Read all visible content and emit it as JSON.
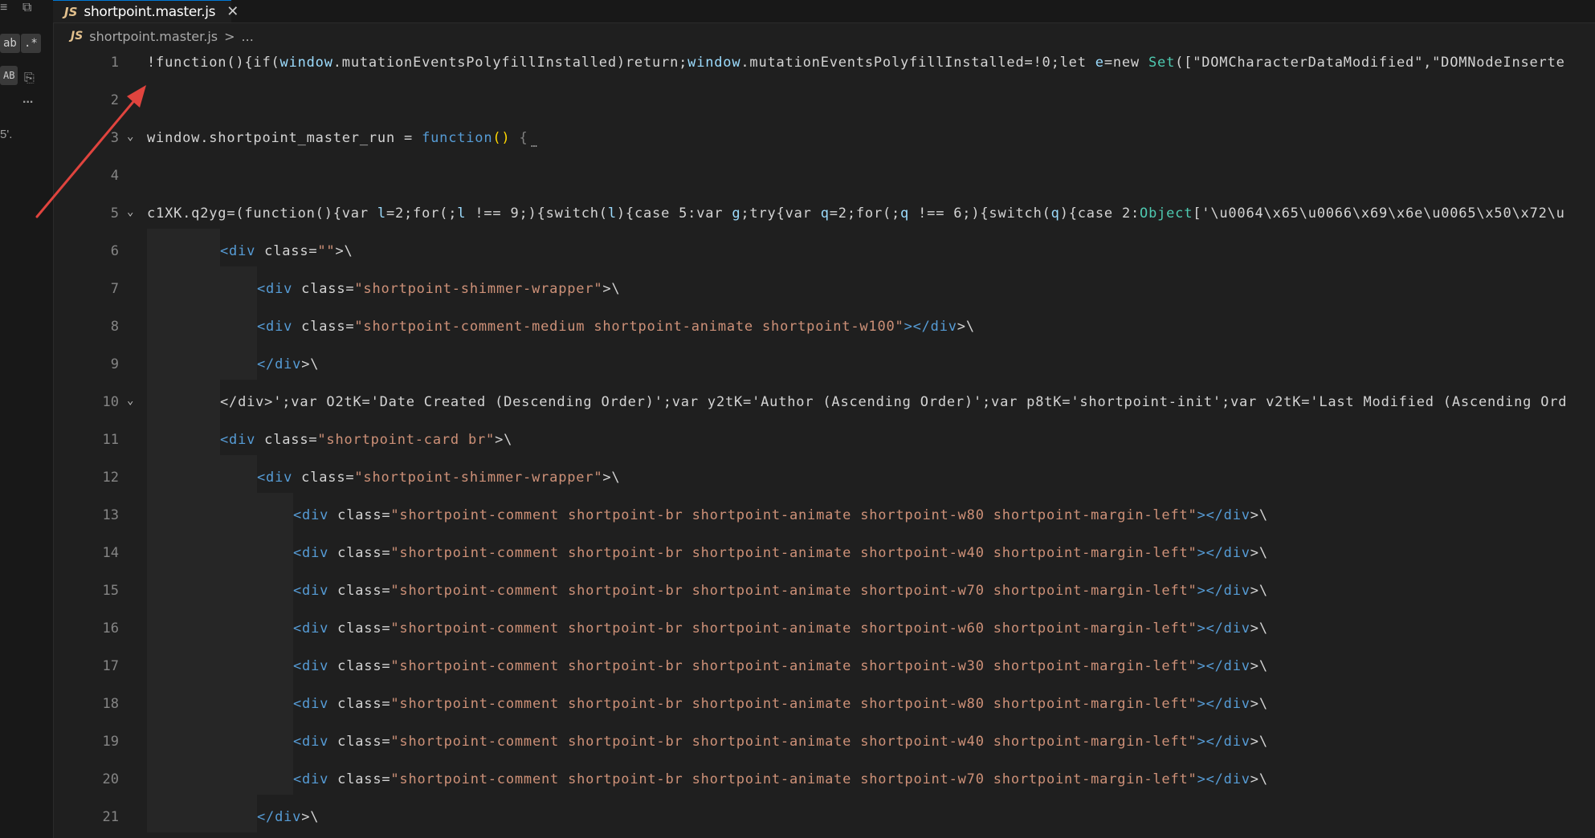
{
  "leftbar": {
    "match_case_label": "ab",
    "regex_label": ".*",
    "ab_label": "AB",
    "more_label": "...",
    "fragment_text": "5'."
  },
  "tab": {
    "icon": "JS",
    "title": "shortpoint.master.js",
    "close": "✕"
  },
  "breadcrumb": {
    "icon": "JS",
    "file": "shortpoint.master.js",
    "separator": ">",
    "more": "..."
  },
  "editor": {
    "lines": [
      {
        "number": "1",
        "fold": "",
        "indent": "",
        "tokens": [
          {
            "text": "!function(){if(",
            "class": "default"
          },
          {
            "text": "window",
            "class": "variable"
          },
          {
            "text": ".mutationEventsPolyfillInstalled)return;",
            "class": "default"
          },
          {
            "text": "window",
            "class": "variable"
          },
          {
            "text": ".mutationEventsPolyfillInstalled=!0;let ",
            "class": "default"
          },
          {
            "text": "e",
            "class": "variable"
          },
          {
            "text": "=new ",
            "class": "default"
          },
          {
            "text": "Set",
            "class": "class"
          },
          {
            "text": "([\"DOMCharacterDataModified\",\"DOMNodeInserte",
            "class": "default"
          }
        ]
      },
      {
        "number": "2",
        "fold": "",
        "indent": "",
        "tokens": []
      },
      {
        "number": "3",
        "fold": "⌄",
        "indent": "",
        "tokens": [
          {
            "text": "window.shortpoint_master_run = ",
            "class": "default"
          },
          {
            "text": "function",
            "class": "keyword"
          },
          {
            "text": "()",
            "class": "bracket"
          },
          {
            "text": " ",
            "class": "default"
          },
          {
            "text": "{",
            "class": "punct"
          }
        ],
        "ellipsis": "…"
      },
      {
        "number": "4",
        "fold": "",
        "indent": "",
        "tokens": []
      },
      {
        "number": "5",
        "fold": "⌄",
        "indent": "",
        "tokens": [
          {
            "text": "c1XK.q2yg=(function(){var ",
            "class": "default"
          },
          {
            "text": "l",
            "class": "variable"
          },
          {
            "text": "=2;for(;",
            "class": "default"
          },
          {
            "text": "l",
            "class": "variable"
          },
          {
            "text": " !== 9;){switch(",
            "class": "default"
          },
          {
            "text": "l",
            "class": "variable"
          },
          {
            "text": "){case 5:var ",
            "class": "default"
          },
          {
            "text": "g",
            "class": "variable"
          },
          {
            "text": ";try{var ",
            "class": "default"
          },
          {
            "text": "q",
            "class": "variable"
          },
          {
            "text": "=2;for(;",
            "class": "default"
          },
          {
            "text": "q",
            "class": "variable"
          },
          {
            "text": " !== 6;){switch(",
            "class": "default"
          },
          {
            "text": "q",
            "class": "variable"
          },
          {
            "text": "){case 2:",
            "class": "default"
          },
          {
            "text": "Object",
            "class": "class"
          },
          {
            "text": "['\\u0064\\x65\\u0066\\x69\\x6e\\u0065\\x50\\x72\\u",
            "class": "default"
          }
        ]
      },
      {
        "number": "6",
        "fold": "",
        "indent": "    ",
        "tokens": [
          {
            "text": "<div",
            "class": "tag"
          },
          {
            "text": " class=",
            "class": "default"
          },
          {
            "text": "\"\"",
            "class": "string"
          },
          {
            "text": ">\\",
            "class": "default"
          }
        ]
      },
      {
        "number": "7",
        "fold": "",
        "indent": "      ",
        "tokens": [
          {
            "text": "<div",
            "class": "tag"
          },
          {
            "text": " class=",
            "class": "default"
          },
          {
            "text": "\"shortpoint-shimmer-wrapper\"",
            "class": "string"
          },
          {
            "text": ">\\",
            "class": "default"
          }
        ]
      },
      {
        "number": "8",
        "fold": "",
        "indent": "      ",
        "tokens": [
          {
            "text": "<div",
            "class": "tag"
          },
          {
            "text": " class=",
            "class": "default"
          },
          {
            "text": "\"shortpoint-comment-medium shortpoint-animate shortpoint-w100\"",
            "class": "string"
          },
          {
            "text": "></div",
            "class": "tag"
          },
          {
            "text": ">\\",
            "class": "default"
          }
        ]
      },
      {
        "number": "9",
        "fold": "",
        "indent": "      ",
        "tokens": [
          {
            "text": "</div",
            "class": "tag"
          },
          {
            "text": ">\\",
            "class": "default"
          }
        ]
      },
      {
        "number": "10",
        "fold": "⌄",
        "indent": "    ",
        "tokens": [
          {
            "text": "</div>';var O2tK='Date Created (Descending Order)';var y2tK='Author (Ascending Order)';var p8tK='shortpoint-init';var v2tK='Last Modified (Ascending Ord",
            "class": "default"
          }
        ]
      },
      {
        "number": "11",
        "fold": "",
        "indent": "    ",
        "tokens": [
          {
            "text": "<div",
            "class": "tag"
          },
          {
            "text": " class=",
            "class": "default"
          },
          {
            "text": "\"shortpoint-card br\"",
            "class": "string"
          },
          {
            "text": ">\\",
            "class": "default"
          }
        ]
      },
      {
        "number": "12",
        "fold": "",
        "indent": "      ",
        "tokens": [
          {
            "text": "<div",
            "class": "tag"
          },
          {
            "text": " class=",
            "class": "default"
          },
          {
            "text": "\"shortpoint-shimmer-wrapper\"",
            "class": "string"
          },
          {
            "text": ">\\",
            "class": "default"
          }
        ]
      },
      {
        "number": "13",
        "fold": "",
        "indent": "        ",
        "tokens": [
          {
            "text": "<div",
            "class": "tag"
          },
          {
            "text": " class=",
            "class": "default"
          },
          {
            "text": "\"shortpoint-comment shortpoint-br shortpoint-animate shortpoint-w80 shortpoint-margin-left\"",
            "class": "string"
          },
          {
            "text": "></div",
            "class": "tag"
          },
          {
            "text": ">\\",
            "class": "default"
          }
        ]
      },
      {
        "number": "14",
        "fold": "",
        "indent": "        ",
        "tokens": [
          {
            "text": "<div",
            "class": "tag"
          },
          {
            "text": " class=",
            "class": "default"
          },
          {
            "text": "\"shortpoint-comment shortpoint-br shortpoint-animate shortpoint-w40 shortpoint-margin-left\"",
            "class": "string"
          },
          {
            "text": "></div",
            "class": "tag"
          },
          {
            "text": ">\\",
            "class": "default"
          }
        ]
      },
      {
        "number": "15",
        "fold": "",
        "indent": "        ",
        "tokens": [
          {
            "text": "<div",
            "class": "tag"
          },
          {
            "text": " class=",
            "class": "default"
          },
          {
            "text": "\"shortpoint-comment shortpoint-br shortpoint-animate shortpoint-w70 shortpoint-margin-left\"",
            "class": "string"
          },
          {
            "text": "></div",
            "class": "tag"
          },
          {
            "text": ">\\",
            "class": "default"
          }
        ]
      },
      {
        "number": "16",
        "fold": "",
        "indent": "        ",
        "tokens": [
          {
            "text": "<div",
            "class": "tag"
          },
          {
            "text": " class=",
            "class": "default"
          },
          {
            "text": "\"shortpoint-comment shortpoint-br shortpoint-animate shortpoint-w60 shortpoint-margin-left\"",
            "class": "string"
          },
          {
            "text": "></div",
            "class": "tag"
          },
          {
            "text": ">\\",
            "class": "default"
          }
        ]
      },
      {
        "number": "17",
        "fold": "",
        "indent": "        ",
        "tokens": [
          {
            "text": "<div",
            "class": "tag"
          },
          {
            "text": " class=",
            "class": "default"
          },
          {
            "text": "\"shortpoint-comment shortpoint-br shortpoint-animate shortpoint-w30 shortpoint-margin-left\"",
            "class": "string"
          },
          {
            "text": "></div",
            "class": "tag"
          },
          {
            "text": ">\\",
            "class": "default"
          }
        ]
      },
      {
        "number": "18",
        "fold": "",
        "indent": "        ",
        "tokens": [
          {
            "text": "<div",
            "class": "tag"
          },
          {
            "text": " class=",
            "class": "default"
          },
          {
            "text": "\"shortpoint-comment shortpoint-br shortpoint-animate shortpoint-w80 shortpoint-margin-left\"",
            "class": "string"
          },
          {
            "text": "></div",
            "class": "tag"
          },
          {
            "text": ">\\",
            "class": "default"
          }
        ]
      },
      {
        "number": "19",
        "fold": "",
        "indent": "        ",
        "tokens": [
          {
            "text": "<div",
            "class": "tag"
          },
          {
            "text": " class=",
            "class": "default"
          },
          {
            "text": "\"shortpoint-comment shortpoint-br shortpoint-animate shortpoint-w40 shortpoint-margin-left\"",
            "class": "string"
          },
          {
            "text": "></div",
            "class": "tag"
          },
          {
            "text": ">\\",
            "class": "default"
          }
        ]
      },
      {
        "number": "20",
        "fold": "",
        "indent": "        ",
        "tokens": [
          {
            "text": "<div",
            "class": "tag"
          },
          {
            "text": " class=",
            "class": "default"
          },
          {
            "text": "\"shortpoint-comment shortpoint-br shortpoint-animate shortpoint-w70 shortpoint-margin-left\"",
            "class": "string"
          },
          {
            "text": "></div",
            "class": "tag"
          },
          {
            "text": ">\\",
            "class": "default"
          }
        ]
      },
      {
        "number": "21",
        "fold": "",
        "indent": "      ",
        "tokens": [
          {
            "text": "</div",
            "class": "tag"
          },
          {
            "text": ">\\",
            "class": "default"
          }
        ]
      }
    ]
  },
  "colors": {
    "background": "#1f1f1f",
    "annotation_arrow": "#e0443e",
    "keyword": "#569cd6",
    "string": "#ce9178",
    "class": "#4ec9b0",
    "variable": "#9cdcfe",
    "accent": "#0078d4"
  }
}
